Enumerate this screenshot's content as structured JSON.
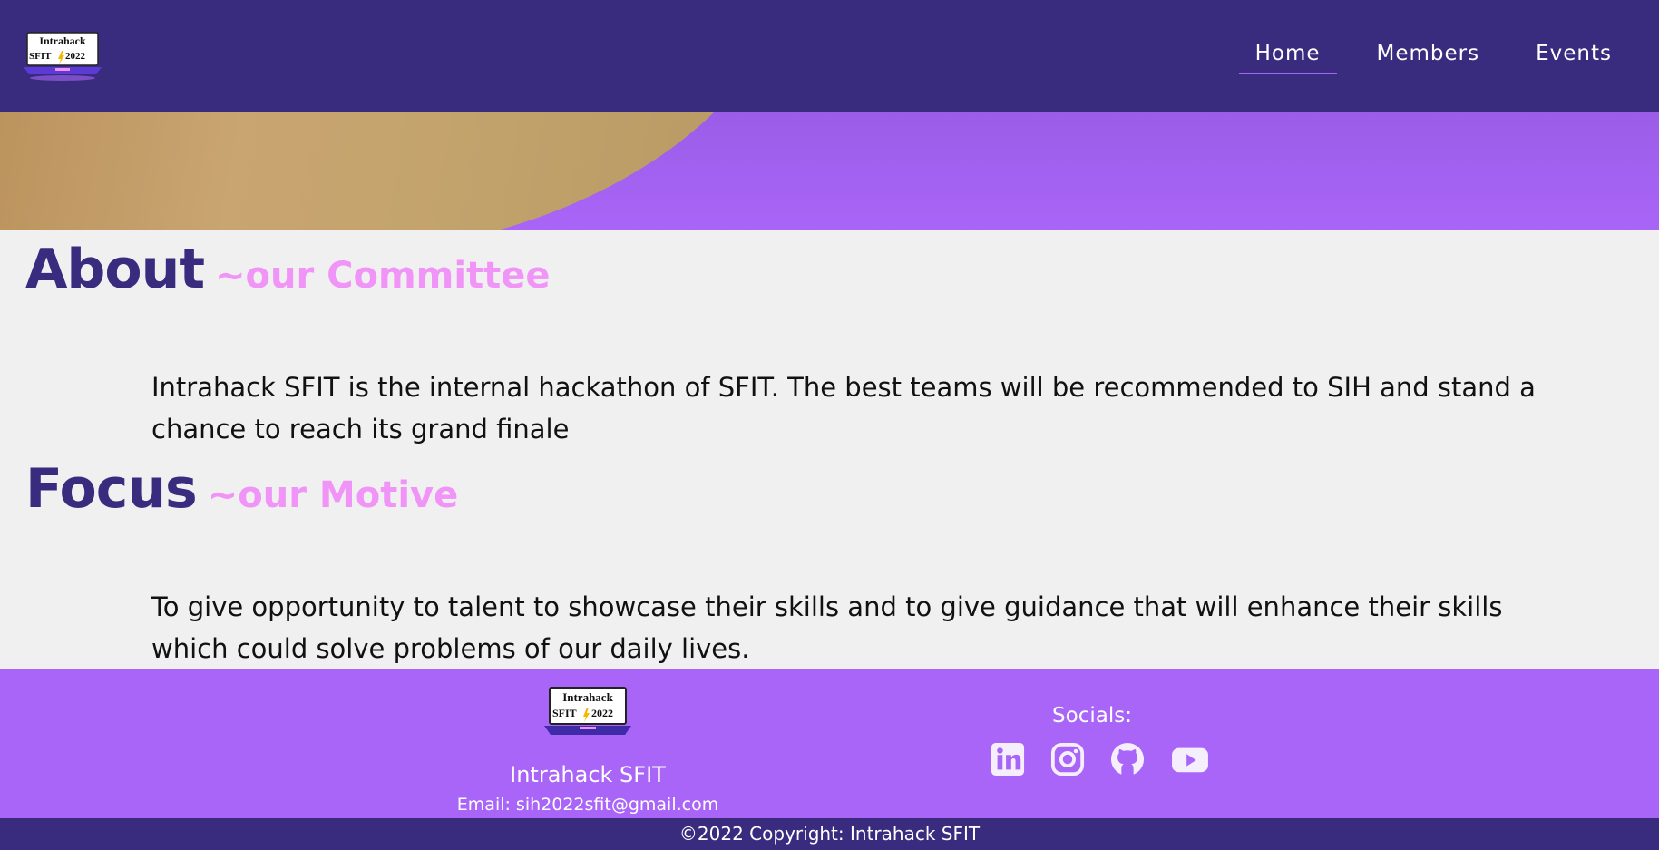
{
  "brand": {
    "logo_line1": "Intrahack",
    "logo_line2_left": "SFIT",
    "logo_line2_right": "2022"
  },
  "nav": {
    "items": [
      {
        "label": "Home",
        "active": true
      },
      {
        "label": "Members",
        "active": false
      },
      {
        "label": "Events",
        "active": false
      }
    ]
  },
  "about": {
    "title": "About",
    "subtitle": "~our Committee",
    "text": "Intrahack SFIT is the internal hackathon of SFIT. The best teams will be recommended to SIH and stand a chance to reach its grand finale"
  },
  "focus": {
    "title": "Focus",
    "subtitle": "~our Motive",
    "text": "To give opportunity to talent to showcase their skills and to give guidance that will enhance their skills which could solve problems of our daily lives."
  },
  "footer": {
    "name": "Intrahack SFIT",
    "email": "Email: sih2022sfit@gmail.com",
    "socials_title": "Socials:",
    "socials": [
      "linkedin-icon",
      "instagram-icon",
      "github-icon",
      "youtube-icon"
    ],
    "copyright": "©2022 Copyright: Intrahack SFIT"
  },
  "colors": {
    "navbar": "#392c7f",
    "accent": "#a965f7",
    "heading": "#392c7f",
    "subheading": "#f095f7"
  }
}
